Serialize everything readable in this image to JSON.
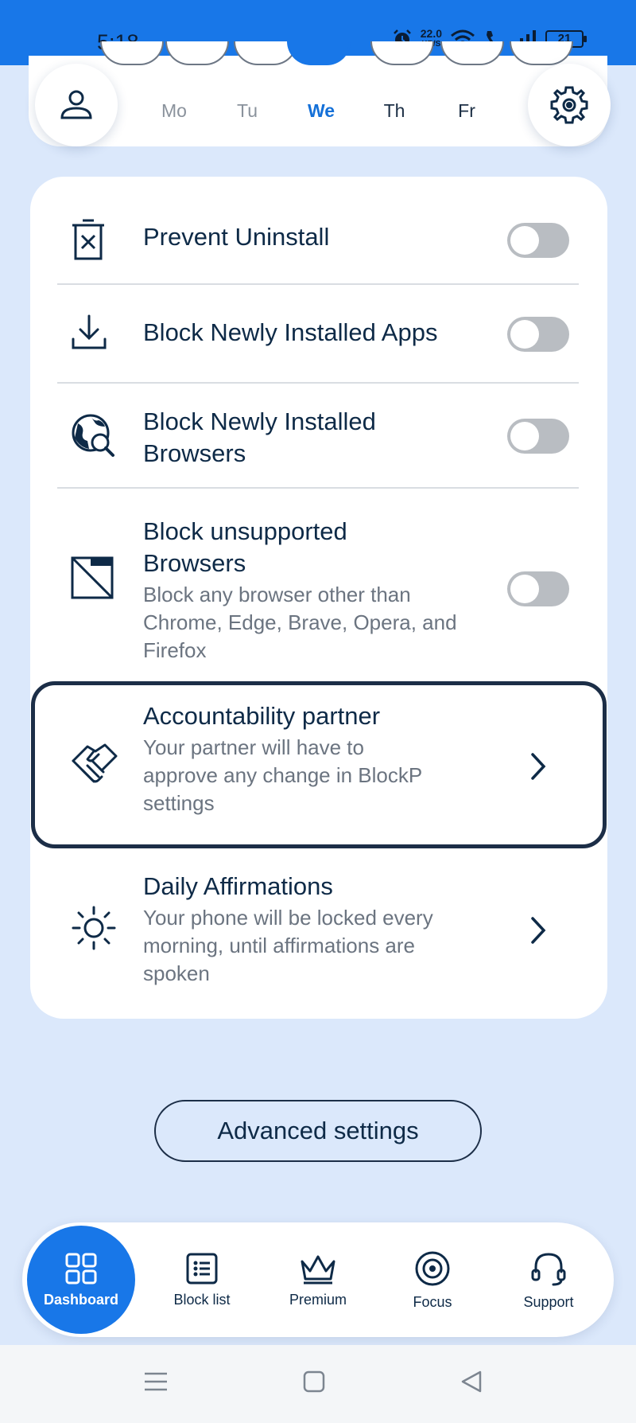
{
  "status_bar": {
    "time": "5:18",
    "net_speed": "22.0",
    "net_unit": "KB/S",
    "battery": "21"
  },
  "day_strip": {
    "days": [
      {
        "label": "Mo"
      },
      {
        "label": "Tu"
      },
      {
        "label": "We",
        "active": true
      },
      {
        "label": "Th"
      },
      {
        "label": "Fr"
      }
    ]
  },
  "settings": {
    "prevent_uninstall": {
      "title": "Prevent Uninstall",
      "enabled": false
    },
    "block_new_apps": {
      "title": "Block Newly Installed Apps",
      "enabled": false
    },
    "block_new_browsers": {
      "title_line1": "Block Newly Installed",
      "title_line2": "Browsers",
      "enabled": false
    },
    "block_unsupported": {
      "title_line1": "Block unsupported",
      "title_line2": "Browsers",
      "desc_line1": "Block any browser other than",
      "desc_line2": "Chrome, Edge, Brave, Opera, and",
      "desc_line3": "Firefox",
      "enabled": false
    },
    "accountability": {
      "title": "Accountability partner",
      "desc_line1": "Your partner will have to",
      "desc_line2": "approve any change in BlockP",
      "desc_line3": "settings"
    },
    "affirmations": {
      "title": "Daily Affirmations",
      "desc_line1": "Your phone will be locked every",
      "desc_line2": "morning, until affirmations are",
      "desc_line3": "spoken"
    }
  },
  "advanced_button": "Advanced settings",
  "bottom_nav": {
    "dashboard": "Dashboard",
    "block_list": "Block list",
    "premium": "Premium",
    "focus": "Focus",
    "support": "Support"
  },
  "colors": {
    "accent": "#1877e8",
    "background": "#dbe8fb",
    "text": "#0e2a47"
  },
  "icons": [
    "alarm-icon",
    "wifi-icon",
    "call-icon",
    "signal-icon",
    "battery-icon",
    "profile-icon",
    "gear-icon",
    "trash-x-icon",
    "download-icon",
    "globe-search-icon",
    "browser-slash-icon",
    "handshake-icon",
    "sun-icon",
    "chevron-right-icon",
    "grid-icon",
    "list-icon",
    "crown-icon",
    "target-icon",
    "headset-icon",
    "menu-icon",
    "home-icon",
    "back-icon"
  ]
}
